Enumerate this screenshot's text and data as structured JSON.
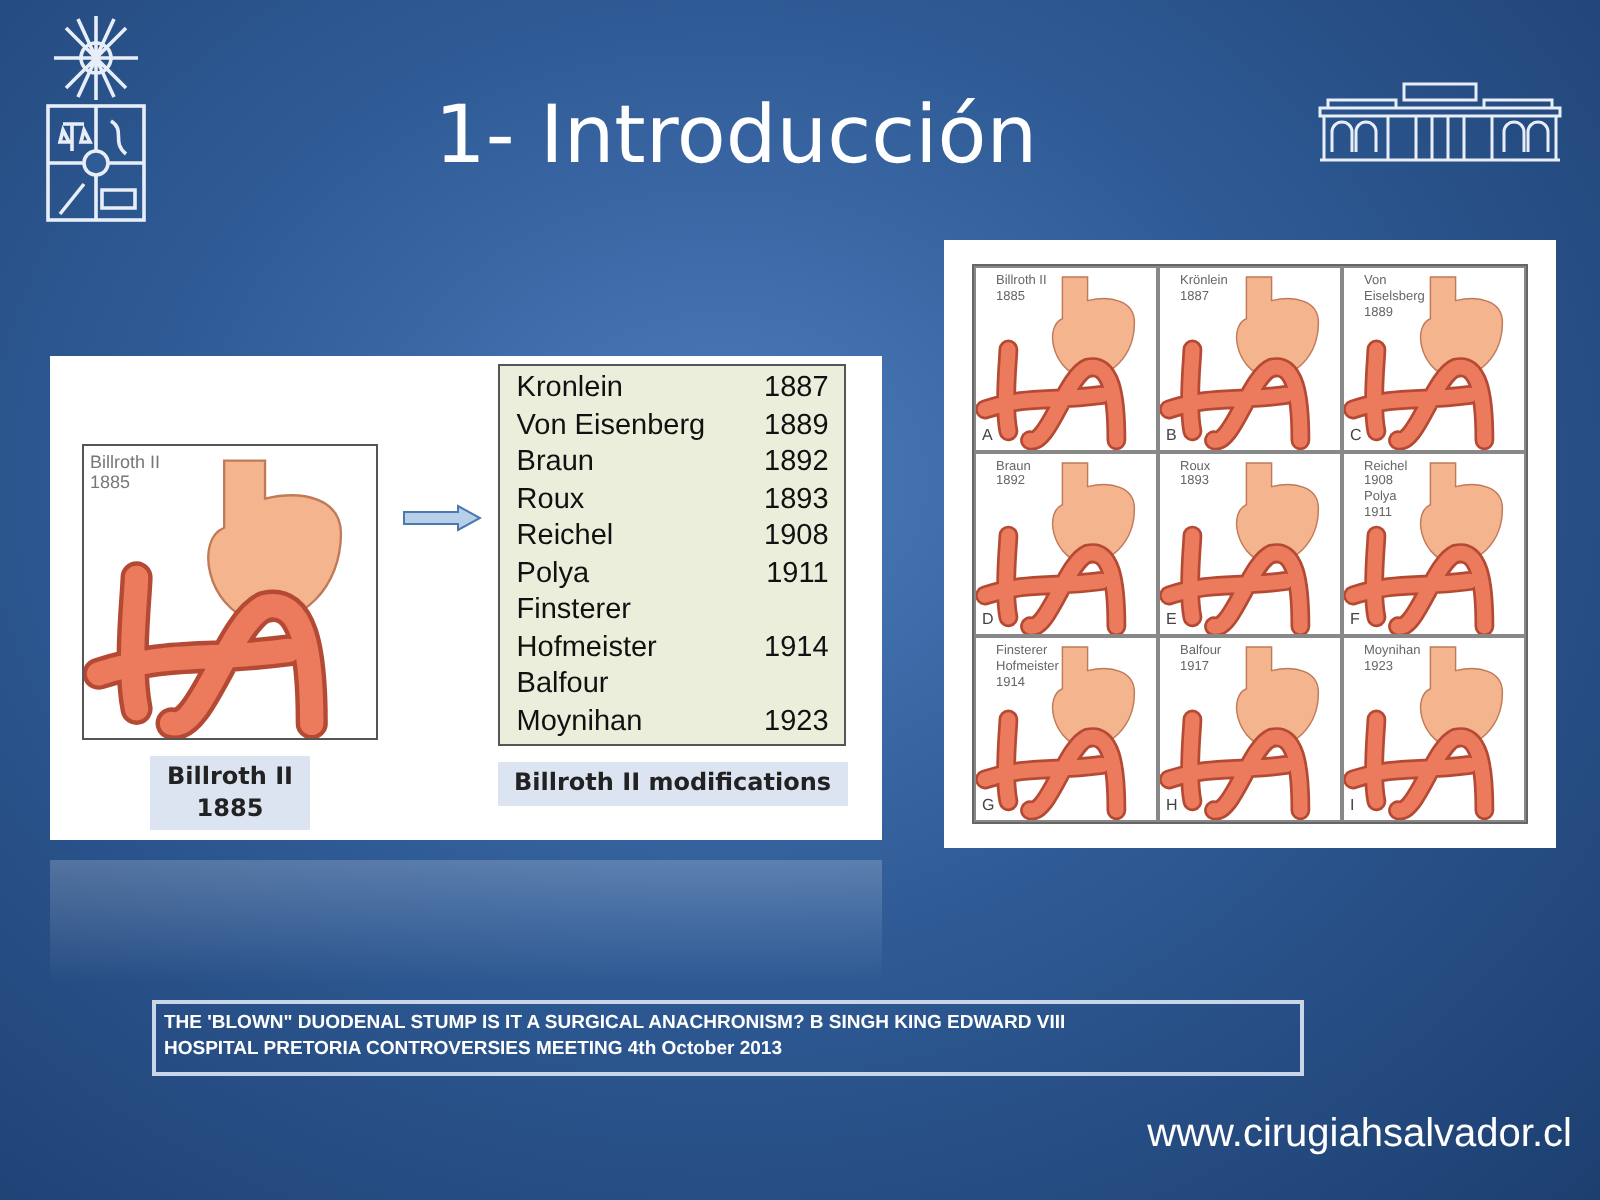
{
  "slide": {
    "title": "1- Introducción"
  },
  "left_figure": {
    "image_label": [
      "Billroth II",
      "1885"
    ],
    "caption": [
      "Billroth II",
      "1885"
    ],
    "modifications": [
      {
        "name": "Kronlein",
        "year": "1887"
      },
      {
        "name": "Von Eisenberg",
        "year": "1889"
      },
      {
        "name": "Braun",
        "year": "1892"
      },
      {
        "name": "Roux",
        "year": "1893"
      },
      {
        "name": "Reichel",
        "year": "1908"
      },
      {
        "name": "Polya",
        "year": "1911"
      },
      {
        "name": "Finsterer"
      },
      {
        "name": "Hofmeister",
        "year": "1914"
      },
      {
        "name": "Balfour"
      },
      {
        "name": "Moynihan",
        "year": "1923"
      }
    ],
    "modifications_caption": "Billroth II modifications"
  },
  "right_figure": {
    "panels": [
      {
        "label": [
          "Billroth II",
          "1885"
        ],
        "letter": "A"
      },
      {
        "label": [
          "Krönlein",
          "1887"
        ],
        "letter": "B"
      },
      {
        "label": [
          "Von",
          "Eiselsberg",
          "1889"
        ],
        "letter": "C"
      },
      {
        "label": [
          "Braun",
          "1892"
        ],
        "letter": "D"
      },
      {
        "label": [
          "Roux",
          "1893"
        ],
        "letter": "E"
      },
      {
        "label": [
          "Reichel",
          "1908",
          "Polya",
          "1911"
        ],
        "letter": "F"
      },
      {
        "label": [
          "Finsterer",
          "Hofmeister",
          "1914"
        ],
        "letter": "G"
      },
      {
        "label": [
          "Balfour",
          "1917"
        ],
        "letter": "H"
      },
      {
        "label": [
          "Moynihan",
          "1923"
        ],
        "letter": "I"
      }
    ]
  },
  "reference": [
    "THE 'BLOWN\" DUODENAL  STUMP IS IT A SURGICAL  ANACHRONISM?  B SINGH  KING EDWARD  VIII",
    "HOSPITAL  PRETORIA CONTROVERSIES  MEETING  4th October  2013"
  ],
  "footer_url": "www.cirugiahsalvador.cl"
}
